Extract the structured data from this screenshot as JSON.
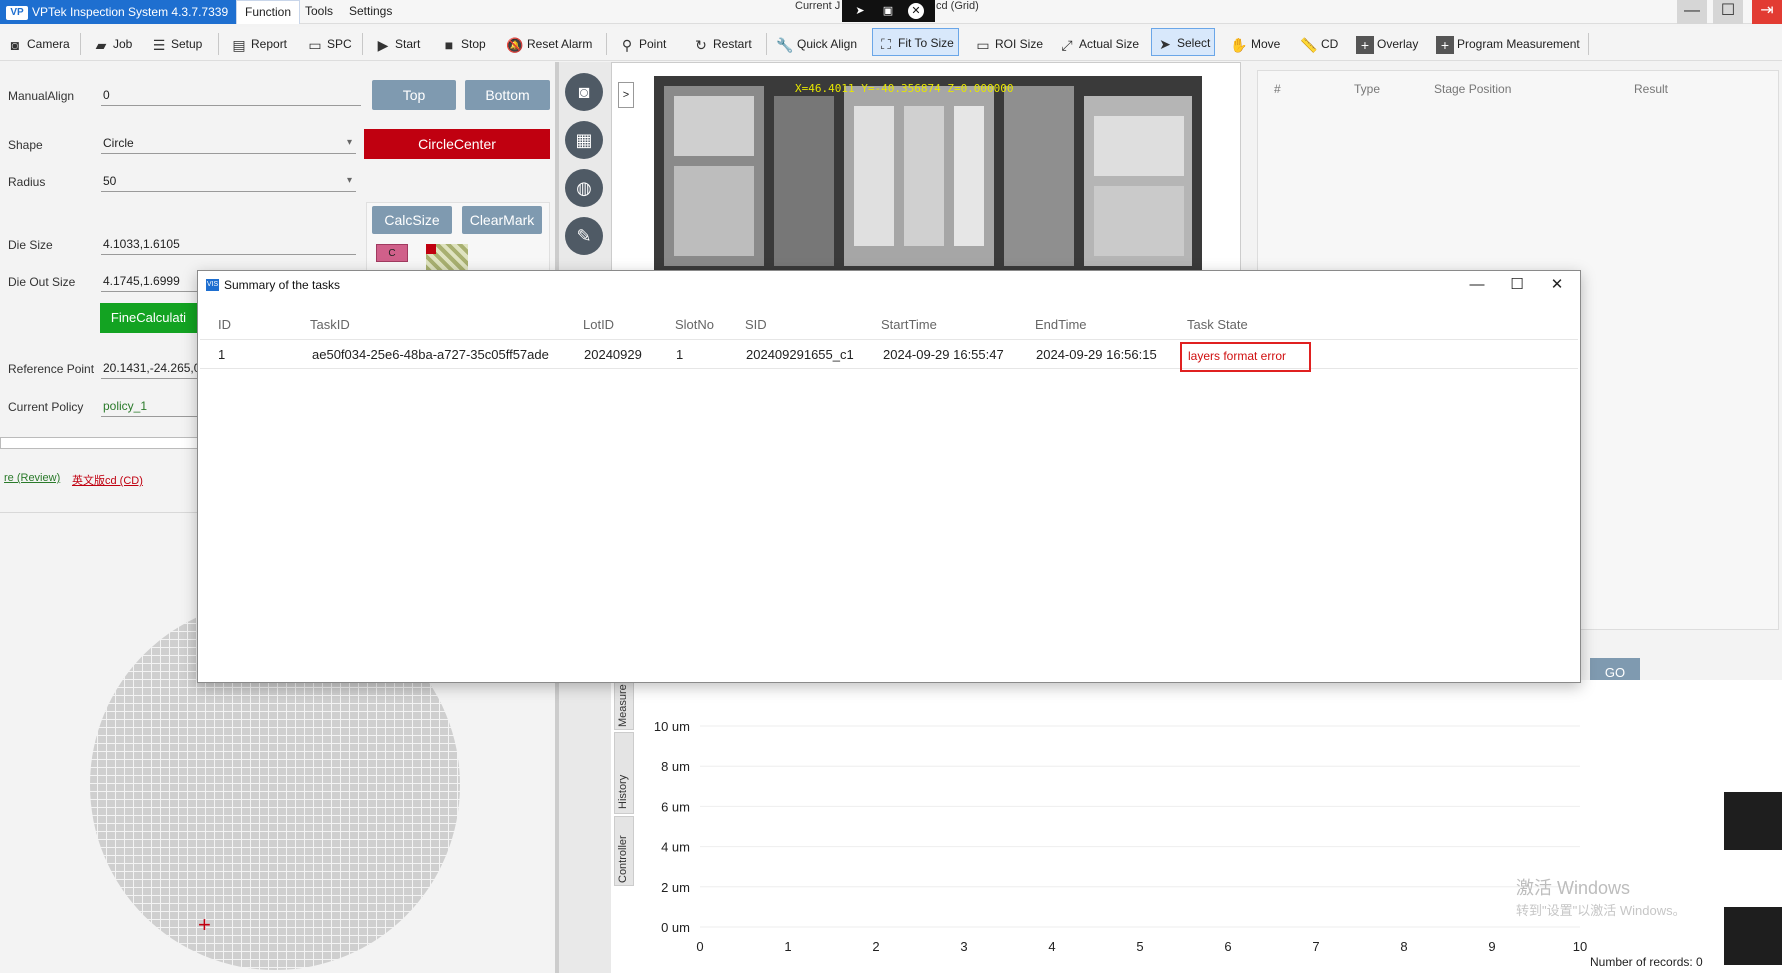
{
  "app": {
    "title": "VPTek Inspection System 4.3.7.7339",
    "logo_text": "VP",
    "menus": [
      "Function",
      "Tools",
      "Settings"
    ],
    "current_label": "Current J",
    "grid_label": "cd (Grid)"
  },
  "window_controls": {
    "minimize": "—",
    "maximize": "☐",
    "close": "⇥"
  },
  "toolbar": {
    "camera": "Camera",
    "job": "Job",
    "setup": "Setup",
    "report": "Report",
    "spc": "SPC",
    "start": "Start",
    "stop": "Stop",
    "reset_alarm": "Reset Alarm",
    "point": "Point",
    "restart": "Restart",
    "quick_align": "Quick Align",
    "fit_to_size": "Fit To Size",
    "roi_size": "ROI Size",
    "actual_size": "Actual Size",
    "select": "Select",
    "move": "Move",
    "cd": "CD",
    "overlay": "Overlay",
    "program_measurement": "Program Measurement"
  },
  "left": {
    "manual_align_label": "ManualAlign",
    "manual_align_value": "0",
    "top_btn": "Top",
    "bottom_btn": "Bottom",
    "shape_label": "Shape",
    "shape_value": "Circle",
    "circle_center_btn": "CircleCenter",
    "radius_label": "Radius",
    "radius_value": "50",
    "calcsize_btn": "CalcSize",
    "clearmark_btn": "ClearMark",
    "c_badge": "C",
    "die_size_label": "Die Size",
    "die_size_value": "4.1033,1.6105",
    "die_out_size_label": "Die Out Size",
    "die_out_size_value": "4.1745,1.6999",
    "fine_calc_btn": "FineCalculati",
    "ref_point_label": "Reference Point",
    "ref_point_value": "20.1431,-24.265,0",
    "policy_label": "Current Policy",
    "policy_value": "policy_1",
    "link_review": "re (Review)",
    "link_cd": "英文版cd (CD)"
  },
  "image": {
    "coord_text": "X=46.4011 Y=-40.356874 Z=0.000000"
  },
  "right_panel": {
    "headers": [
      "#",
      "Type",
      "Stage Position",
      "Result"
    ],
    "go_btn": "GO"
  },
  "chart_tabs": [
    "Measure",
    "History",
    "Controller"
  ],
  "chart_data": {
    "type": "line",
    "title": "",
    "xlabel": "",
    "ylabel": "",
    "x_ticks": [
      "0",
      "1",
      "2",
      "3",
      "4",
      "5",
      "6",
      "7",
      "8",
      "9",
      "10"
    ],
    "y_ticks": [
      "10 um",
      "8 um",
      "6 um",
      "4 um",
      "2 um",
      "0 um"
    ],
    "xlim": [
      0,
      10
    ],
    "ylim": [
      0,
      10
    ],
    "series": []
  },
  "records_text": "Number of records: 0",
  "watermark": {
    "line1": "激活 Windows",
    "line2": "转到\"设置\"以激活 Windows。"
  },
  "modal": {
    "title": "Summary of the tasks",
    "icon_text": "VIS",
    "controls": {
      "minimize": "—",
      "maximize": "☐",
      "close": "✕"
    },
    "columns": [
      "ID",
      "TaskID",
      "LotID",
      "SlotNo",
      "SID",
      "StartTime",
      "EndTime",
      "Task State"
    ],
    "rows": [
      {
        "id": "1",
        "task_id": "ae50f034-25e6-48ba-a727-35c05ff57ade",
        "lot_id": "20240929",
        "slot_no": "1",
        "sid": "202409291655_c1",
        "start_time": "2024-09-29 16:55:47",
        "end_time": "2024-09-29 16:56:15",
        "state": "layers format error"
      }
    ]
  },
  "colors": {
    "accent": "#1e6fd0",
    "error": "#e02020",
    "danger_btn": "#c00010",
    "success_btn": "#13a322"
  }
}
